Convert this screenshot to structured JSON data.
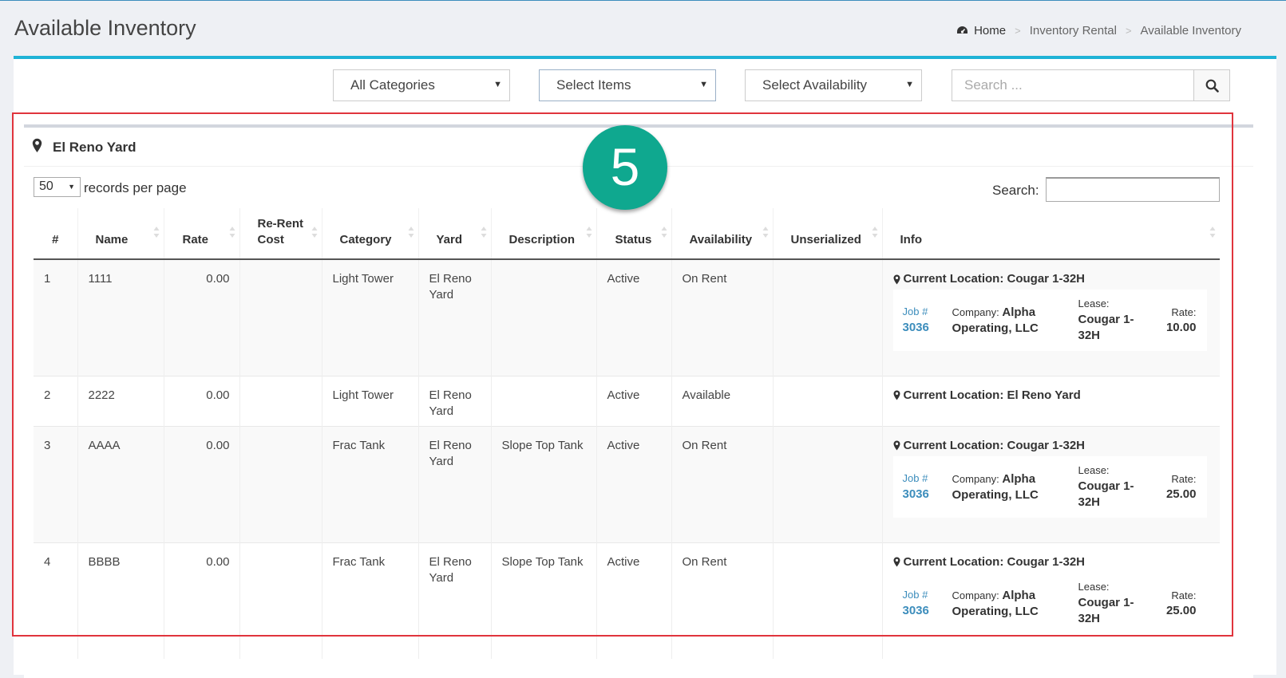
{
  "page": {
    "title": "Available Inventory"
  },
  "breadcrumb": {
    "home": "Home",
    "level1": "Inventory Rental",
    "current": "Available Inventory"
  },
  "filters": {
    "categories": "All Categories",
    "items": "Select Items",
    "availability": "Select Availability",
    "search_placeholder": "Search ..."
  },
  "panel": {
    "title": "El Reno Yard",
    "length_value": "50",
    "length_label": "records per page",
    "search_label": "Search:"
  },
  "table": {
    "headers": [
      "#",
      "Name",
      "Rate",
      "Re-Rent Cost",
      "Category",
      "Yard",
      "Description",
      "Status",
      "Availability",
      "Unserialized",
      "Info"
    ],
    "rows": [
      {
        "num": "1",
        "name": "1111",
        "rate": "0.00",
        "rerent": "",
        "category": "Light Tower",
        "yard": "El Reno Yard",
        "description": "",
        "status": "Active",
        "availability": "On Rent",
        "unserialized": "",
        "location": "Current Location: Cougar 1-32H",
        "job_label": "Job #",
        "job_number": "3036",
        "company_label": "Company:",
        "company": "Alpha Operating, LLC",
        "lease_label": "Lease:",
        "lease": "Cougar 1-32H",
        "rate_label": "Rate:",
        "lease_rate": "10.00"
      },
      {
        "num": "2",
        "name": "2222",
        "rate": "0.00",
        "rerent": "",
        "category": "Light Tower",
        "yard": "El Reno Yard",
        "description": "",
        "status": "Active",
        "availability": "Available",
        "unserialized": "",
        "location": "Current Location: El Reno Yard"
      },
      {
        "num": "3",
        "name": "AAAA",
        "rate": "0.00",
        "rerent": "",
        "category": "Frac Tank",
        "yard": "El Reno Yard",
        "description": "Slope Top Tank",
        "status": "Active",
        "availability": "On Rent",
        "unserialized": "",
        "location": "Current Location: Cougar 1-32H",
        "job_label": "Job #",
        "job_number": "3036",
        "company_label": "Company:",
        "company": "Alpha Operating, LLC",
        "lease_label": "Lease:",
        "lease": "Cougar 1-32H",
        "rate_label": "Rate:",
        "lease_rate": "25.00"
      },
      {
        "num": "4",
        "name": "BBBB",
        "rate": "0.00",
        "rerent": "",
        "category": "Frac Tank",
        "yard": "El Reno Yard",
        "description": "Slope Top Tank",
        "status": "Active",
        "availability": "On Rent",
        "unserialized": "",
        "location": "Current Location: Cougar 1-32H",
        "job_label": "Job #",
        "job_number": "3036",
        "company_label": "Company:",
        "company": "Alpha Operating, LLC",
        "lease_label": "Lease:",
        "lease": "Cougar 1-32H",
        "rate_label": "Rate:",
        "lease_rate": "25.00"
      }
    ]
  },
  "annotation": {
    "step": "5"
  },
  "colors": {
    "accent": "#1fb3d6",
    "link": "#3c8dbc",
    "highlight": "#e0343d",
    "badge": "#0fa88f"
  }
}
